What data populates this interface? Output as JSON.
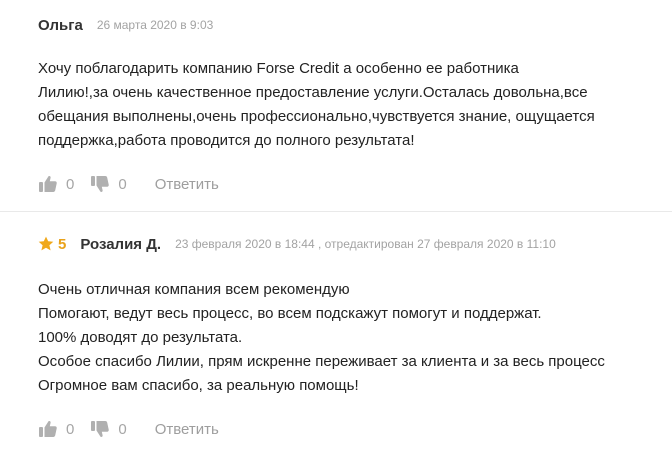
{
  "reviews": [
    {
      "author": "Ольга",
      "meta": "26 марта 2020 в 9:03",
      "lines": [
        "Хочу поблагодарить компанию Forse Credit а особенно ее работника",
        "Лилию!,за очень качественное предоставление услуги.Осталась довольна,все",
        "обещания выполнены,очень профессионально,чувствуется знание, ощущается",
        "поддержка,работа проводится до полного результата!"
      ],
      "likes": "0",
      "dislikes": "0",
      "reply_label": "Ответить"
    },
    {
      "rating": "5",
      "author": "Розалия Д.",
      "meta": "23 февраля 2020 в 18:44 , отредактирован 27 февраля 2020 в 11:10",
      "lines": [
        "Очень отличная компания всем рекомендую",
        "Помогают, ведут весь процесс, во всем подскажут помогут и поддержат.",
        "100% доводят до результата.",
        "Особое спасибо Лилии, прям искренне переживает за клиента и за весь процесс",
        "Огромное вам спасибо, за реальную помощь!"
      ],
      "likes": "0",
      "dislikes": "0",
      "reply_label": "Ответить"
    }
  ],
  "icons": {
    "like": "thumbs-up-icon",
    "dislike": "thumbs-down-icon",
    "rating": "star-icon"
  },
  "colors": {
    "star": "#f0a81a",
    "icon": "#b0b0b0",
    "meta": "#a3a3a3"
  }
}
